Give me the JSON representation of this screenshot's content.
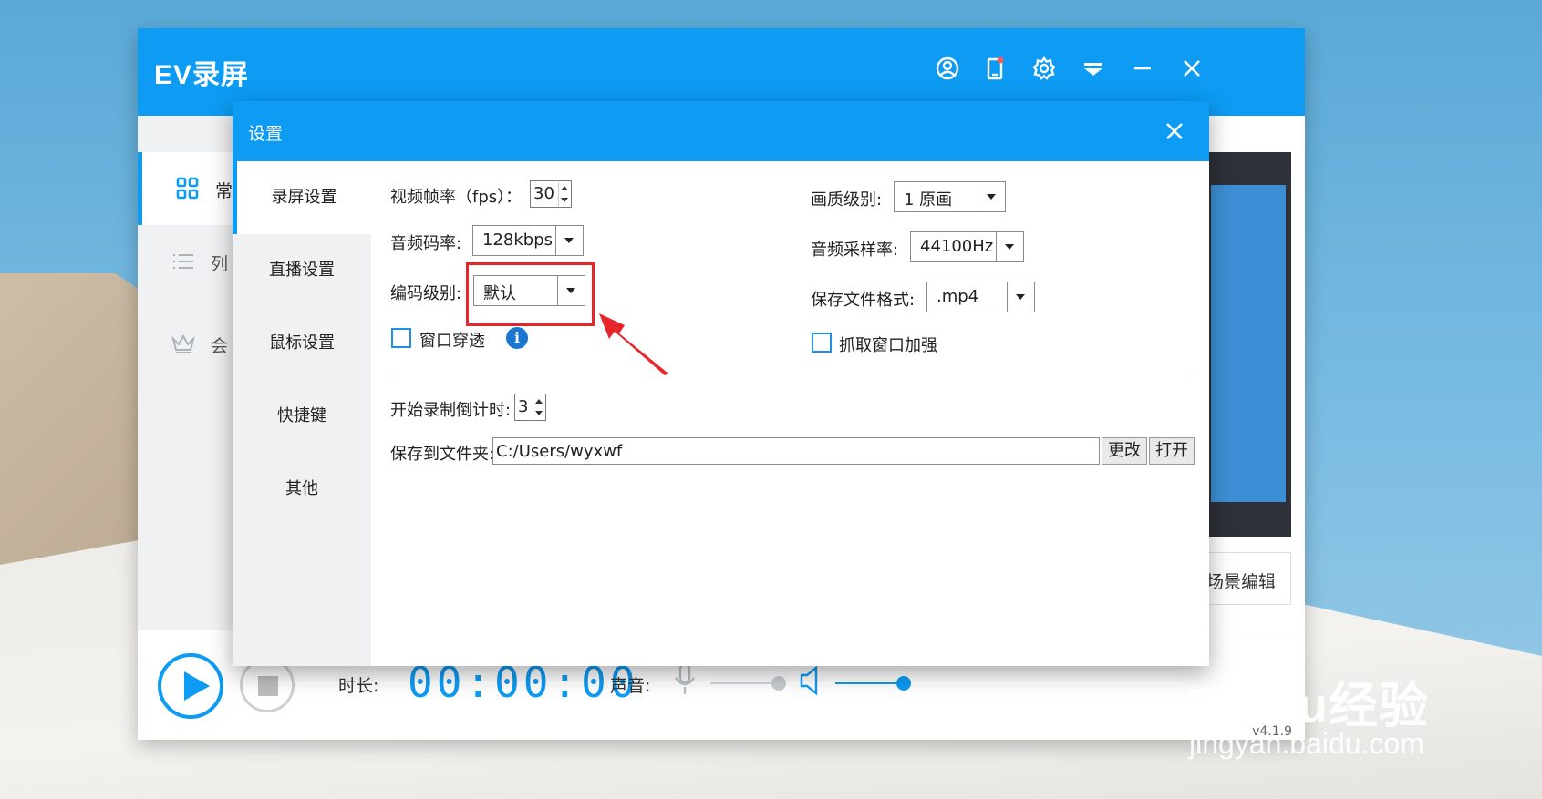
{
  "app": {
    "title": "EV录屏",
    "version": "v4.1.9",
    "sidebar": [
      {
        "label": "常",
        "icon": "grid-icon",
        "active": true
      },
      {
        "label": "列",
        "icon": "list-icon",
        "active": false
      },
      {
        "label": "会",
        "icon": "crown-icon",
        "active": false
      }
    ],
    "scene_edit_label": "场景编辑",
    "bottom": {
      "duration_label": "时长:",
      "duration_value": "00:00:00",
      "sound_label": "声音:"
    }
  },
  "dialog": {
    "title": "设置",
    "tabs": [
      "录屏设置",
      "直播设置",
      "鼠标设置",
      "快捷键",
      "其他"
    ],
    "active_tab": "录屏设置",
    "fields": {
      "fps_label": "视频帧率（fps）：",
      "fps_value": "30",
      "quality_label": "画质级别:",
      "quality_value": "1 原画",
      "audio_bitrate_label": "音频码率:",
      "audio_bitrate_value": "128kbps",
      "sample_rate_label": "音频采样率:",
      "sample_rate_value": "44100Hz",
      "encode_level_label": "编码级别:",
      "encode_level_value": "默认",
      "file_format_label": "保存文件格式:",
      "file_format_value": ".mp4",
      "window_through_label": "窗口穿透",
      "capture_enhance_label": "抓取窗口加强",
      "countdown_label": "开始录制倒计时:",
      "countdown_value": "3",
      "save_folder_label": "保存到文件夹:",
      "save_folder_value": "C:/Users/wyxwf",
      "change_button": "更改",
      "open_button": "打开"
    }
  },
  "watermark": {
    "logo": "Baidu经验",
    "url": "jingyan.baidu.com"
  },
  "colors": {
    "accent": "#0d9bf3",
    "highlight": "#e5262a"
  }
}
